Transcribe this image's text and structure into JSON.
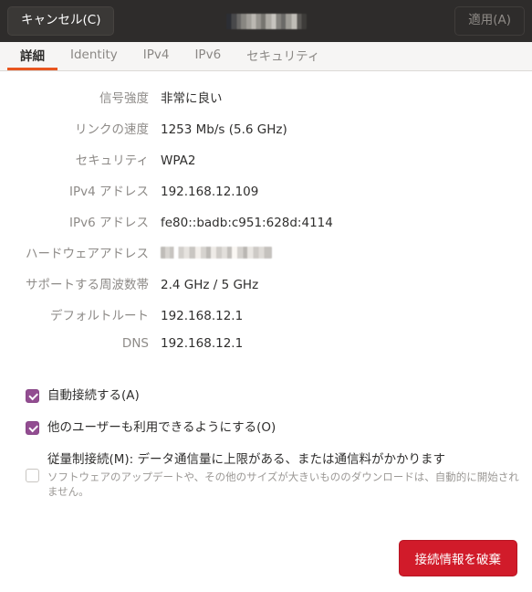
{
  "titlebar": {
    "cancel_label": "キャンセル(C)",
    "apply_label": "適用(A)",
    "title_redacted": true,
    "background_color": "#2e2c2b"
  },
  "tabs": [
    {
      "label": "詳細",
      "active": true
    },
    {
      "label": "Identity",
      "active": false
    },
    {
      "label": "IPv4",
      "active": false
    },
    {
      "label": "IPv6",
      "active": false
    },
    {
      "label": "セキュリティ",
      "active": false
    }
  ],
  "accent_color": "#e8561f",
  "details": [
    {
      "label": "信号強度",
      "value": "非常に良い"
    },
    {
      "label": "リンクの速度",
      "value": "1253 Mb/s (5.6 GHz)"
    },
    {
      "label": "セキュリティ",
      "value": "WPA2"
    },
    {
      "label": "IPv4 アドレス",
      "value": "192.168.12.109"
    },
    {
      "label": "IPv6 アドレス",
      "value": "fe80::badb:c951:628d:4114"
    },
    {
      "label": "ハードウェアアドレス",
      "value": "",
      "redacted": true
    },
    {
      "label": "サポートする周波数帯",
      "value": "2.4 GHz / 5 GHz"
    },
    {
      "label": "デフォルトルート",
      "value": "192.168.12.1"
    },
    {
      "label": "DNS",
      "value": "192.168.12.1"
    }
  ],
  "checkboxes": {
    "autoconnect": {
      "label": "自動接続する(A)",
      "checked": true
    },
    "allusers": {
      "label": "他のユーザーも利用できるようにする(O)",
      "checked": true
    },
    "metered": {
      "label": "従量制接続(M): データ通信量に上限がある、または通信料がかかります",
      "description": "ソフトウェアのアップデートや、その他のサイズが大きいもののダウンロードは、自動的に開始されません。",
      "checked": false
    },
    "checked_color": "#924d91"
  },
  "footer": {
    "forget_label": "接続情報を破棄",
    "forget_color": "#d11b2a"
  }
}
